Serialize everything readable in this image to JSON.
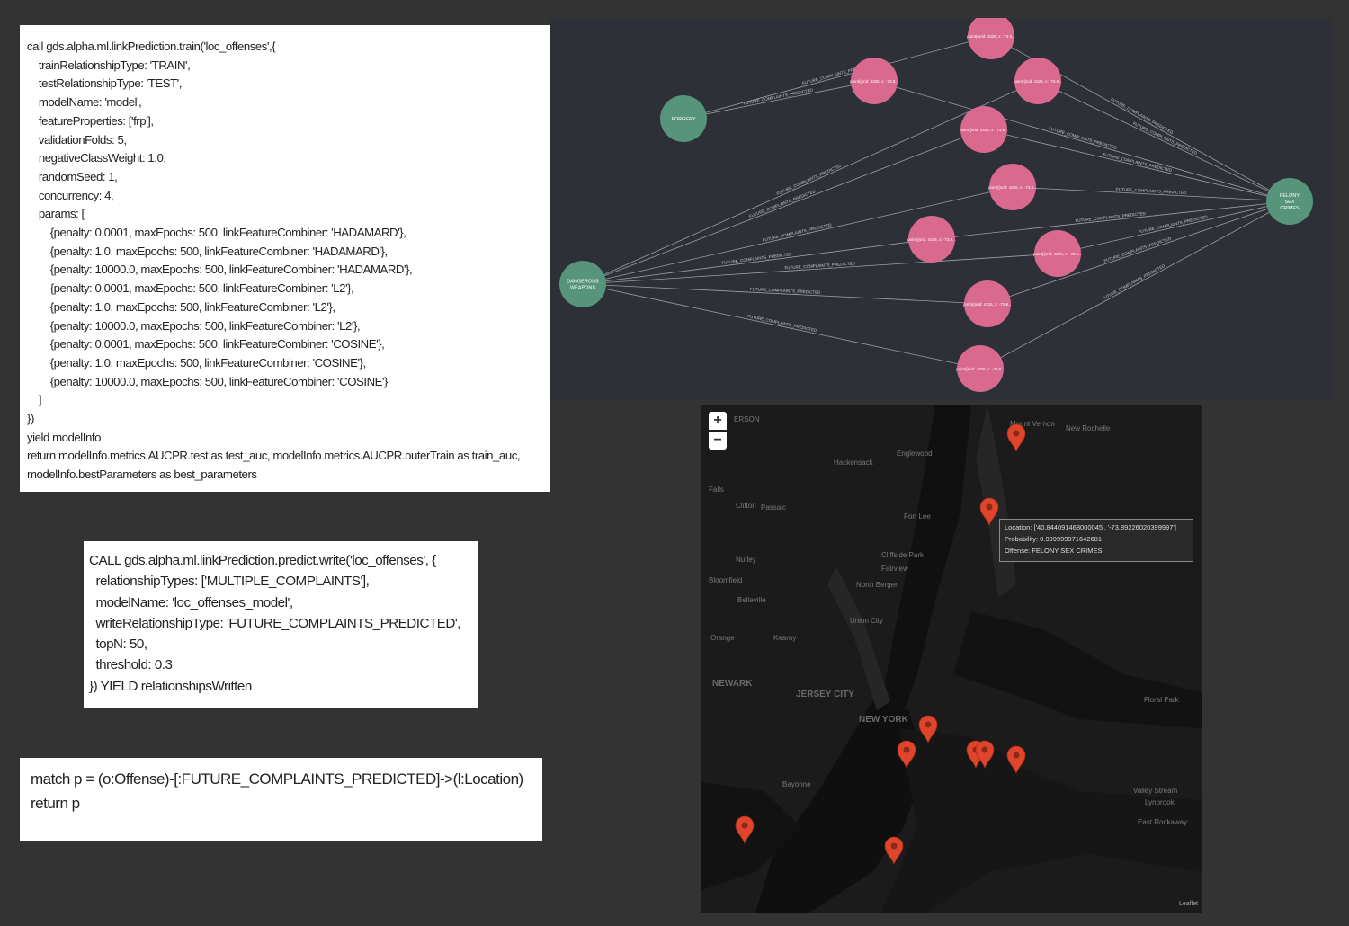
{
  "train_code": [
    "call gds.alpha.ml.linkPrediction.train('loc_offenses',{",
    "    trainRelationshipType: 'TRAIN',",
    "    testRelationshipType: 'TEST',",
    "    modelName: 'model',",
    "    featureProperties: ['frp'],",
    "    validationFolds: 5,",
    "    negativeClassWeight: 1.0,",
    "    randomSeed: 1,",
    "    concurrency: 4,",
    "    params: [",
    "        {penalty: 0.0001, maxEpochs: 500, linkFeatureCombiner: 'HADAMARD'},",
    "        {penalty: 1.0, maxEpochs: 500, linkFeatureCombiner: 'HADAMARD'},",
    "        {penalty: 10000.0, maxEpochs: 500, linkFeatureCombiner: 'HADAMARD'},",
    "        {penalty: 0.0001, maxEpochs: 500, linkFeatureCombiner: 'L2'},",
    "        {penalty: 1.0, maxEpochs: 500, linkFeatureCombiner: 'L2'},",
    "        {penalty: 10000.0, maxEpochs: 500, linkFeatureCombiner: 'L2'},",
    "        {penalty: 0.0001, maxEpochs: 500, linkFeatureCombiner: 'COSINE'},",
    "        {penalty: 1.0, maxEpochs: 500, linkFeatureCombiner: 'COSINE'},",
    "        {penalty: 10000.0, maxEpochs: 500, linkFeatureCombiner: 'COSINE'}",
    "    ]",
    "})",
    "yield modelInfo",
    "return modelInfo.metrics.AUCPR.test as test_auc, modelInfo.metrics.AUCPR.outerTrain as train_auc,",
    "modelInfo.bestParameters as best_parameters"
  ],
  "predict_code": [
    "CALL gds.alpha.ml.linkPrediction.predict.write('loc_offenses', {",
    "  relationshipTypes: ['MULTIPLE_COMPLAINTS'],",
    "  modelName: 'loc_offenses_model',",
    "  writeRelationshipType: 'FUTURE_COMPLAINTS_PREDICTED',",
    "  topN: 50,",
    "  threshold: 0.3",
    "}) YIELD relationshipsWritten"
  ],
  "match_code": [
    "match p = (o:Offense)-[:FUTURE_COMPLAINTS_PREDICTED]->(l:Location)",
    "return p"
  ],
  "graph": {
    "offense_nodes": [
      "FORGERY",
      "DANGEROUS WEAPONS",
      "FELONY SEX CRIMES"
    ],
    "location_label": "point({srid: 4326, x: -73.9...",
    "relationship_label": "FUTURE_COMPLAINTS_PREDICTED",
    "colors": {
      "offense": "#57947c",
      "location": "#d9698f",
      "background": "#2d3036",
      "edge": "#9aa0a6"
    }
  },
  "map": {
    "zoom_in": "+",
    "zoom_out": "−",
    "tooltip": {
      "location": "Location: ['40.844091468000045', '-73.89226020399997']",
      "probability": "Probability: 0.999999971642681",
      "offense": "Offense: FELONY SEX CRIMES"
    },
    "labels": [
      "NEW YORK",
      "NEWARK",
      "JERSEY CITY",
      "Hackensack",
      "Englewood",
      "Fort Lee",
      "Clifton",
      "Passaic",
      "Nutley",
      "Belleville",
      "Bloomfield",
      "Kearny",
      "North Bergen",
      "Union City",
      "Floral Park",
      "Valley Stream",
      "Lynbrook",
      "East Rockaway",
      "New Rochelle",
      "Mount Vernon",
      "Cliffside Park",
      "Fairview",
      "Bayonne",
      "Orange",
      "Falls",
      "ERSON"
    ],
    "credit": "Leaflet",
    "marker_color": "#e0452b"
  }
}
